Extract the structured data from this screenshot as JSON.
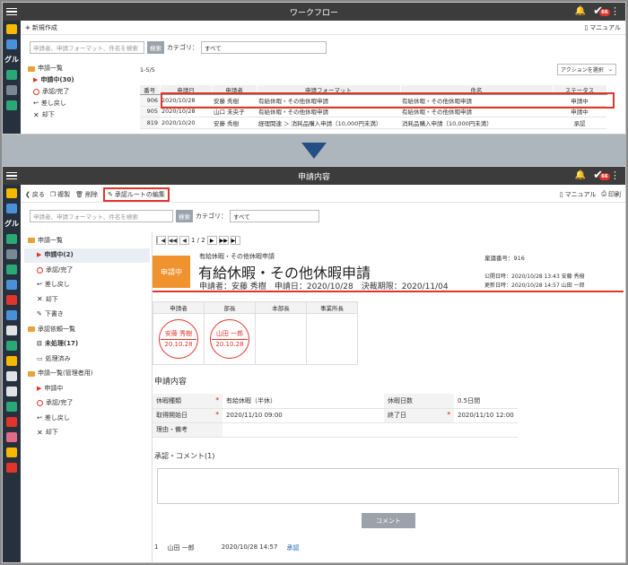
{
  "colors": {
    "nav_bg": "#27313e",
    "titlebar_bg": "#3c3c3c",
    "accent_red": "#e0352b",
    "status_orange": "#f0922e",
    "arrow_blue": "#254e86"
  },
  "badge_count": "66",
  "nav_label": "グル",
  "panel1": {
    "title": "ワークフロー",
    "new_label": "新規作成",
    "manual_label": "マニュアル",
    "search_placeholder": "申請者、申請フォーマット、件名を検索",
    "search_button": "検索",
    "category_label": "カテゴリ：",
    "category_value": "すべて",
    "tree": [
      {
        "label": "申請一覧",
        "icon": "folder-icon"
      },
      {
        "label": "申請中(30)",
        "icon": "play-icon"
      },
      {
        "label": "承認/完了",
        "icon": "circle-icon"
      },
      {
        "label": "差し戻し",
        "icon": "return-icon"
      },
      {
        "label": "却下",
        "icon": "x-icon"
      }
    ],
    "count_text": "1-5/5",
    "action_select": "アクションを選択",
    "columns": [
      "番号",
      "申請日",
      "申請者",
      "申請フォーマット",
      "件名",
      "ステータス"
    ],
    "rows": [
      {
        "no": "906",
        "date": "2020/10/28",
        "user": "安藤 秀樹",
        "format": "有給休暇・その他休暇申請",
        "subject": "有給休暇・その他休暇申請",
        "status": "申請中"
      },
      {
        "no": "905",
        "date": "2020/10/28",
        "user": "山口 未央子",
        "format": "有給休暇・その他休暇申請",
        "subject": "有給休暇・その他休暇申請",
        "status": "申請中"
      },
      {
        "no": "819",
        "date": "2020/10/20",
        "user": "安藤 秀樹",
        "format": "経理関連 ＞ 消耗品購入申請（10,000円未満）",
        "subject": "消耗品購入申請（10,000円未満）",
        "status": "承認"
      }
    ]
  },
  "panel2": {
    "title": "申請内容",
    "back_label": "戻る",
    "copy_label": "複製",
    "delete_label": "削除",
    "edit_route_label": "承認ルートの編集",
    "manual_label": "マニュアル",
    "print_label": "印刷",
    "search_placeholder": "申請者、申請フォーマット、件名を検索",
    "search_button": "検索",
    "category_label": "カテゴリ：",
    "category_value": "すべて",
    "tree": [
      {
        "label": "申請一覧",
        "icon": "folder-icon",
        "indent": 0,
        "bold": false
      },
      {
        "label": "申請中(2)",
        "icon": "play-icon",
        "indent": 1,
        "bold": true
      },
      {
        "label": "承認/完了",
        "icon": "circle-icon",
        "indent": 1,
        "bold": false
      },
      {
        "label": "差し戻し",
        "icon": "return-icon",
        "indent": 1,
        "bold": false
      },
      {
        "label": "却下",
        "icon": "x-icon",
        "indent": 1,
        "bold": false
      },
      {
        "label": "下書き",
        "icon": "pencil-icon",
        "indent": 1,
        "bold": false
      },
      {
        "label": "承認依頼一覧",
        "icon": "folder-icon",
        "indent": 0,
        "bold": false
      },
      {
        "label": "未処理(17)",
        "icon": "inbox-icon",
        "indent": 1,
        "bold": true
      },
      {
        "label": "処理済み",
        "icon": "tray-icon",
        "indent": 1,
        "bold": false
      },
      {
        "label": "申請一覧(管理者用)",
        "icon": "folder-icon",
        "indent": 0,
        "bold": false
      },
      {
        "label": "申請中",
        "icon": "play-icon",
        "indent": 1,
        "bold": false
      },
      {
        "label": "承認/完了",
        "icon": "circle-icon",
        "indent": 1,
        "bold": false
      },
      {
        "label": "差し戻し",
        "icon": "return-icon",
        "indent": 1,
        "bold": false
      },
      {
        "label": "却下",
        "icon": "x-icon",
        "indent": 1,
        "bold": false
      }
    ],
    "pager": "1 / 2",
    "status": "申請中",
    "format_name": "有給休暇・その他休暇申請",
    "subject": "有給休暇・その他休暇申請",
    "applicant_line": "申請者：安藤 秀樹　申請日：2020/10/28　決裁期限：2020/11/04",
    "doc_no": "稟議番号：916",
    "published": "公開日時：2020/10/28 13:43 安藤 秀樹",
    "updated": "更新日時：2020/10/28 14:57 山田 一郎",
    "approval_columns": [
      "申請者",
      "部長",
      "本部長",
      "事業所長"
    ],
    "stamps": [
      {
        "name": "安藤 秀樹",
        "date": "20.10.28"
      },
      {
        "name": "山田 一郎",
        "date": "20.10.28"
      }
    ],
    "details_title": "申請内容",
    "details": [
      {
        "l1": "休暇種類",
        "req1": true,
        "v1": "有給休暇（半休）",
        "l2": "休暇日数",
        "req2": false,
        "v2": "0.5日間"
      },
      {
        "l1": "取得開始日",
        "req1": true,
        "v1": "2020/11/10 09:00",
        "l2": "終了日",
        "req2": true,
        "v2": "2020/11/10 12:00"
      },
      {
        "l1": "理由・備考",
        "req1": false,
        "v1": "",
        "l2": "",
        "req2": false,
        "v2": ""
      }
    ],
    "comments_title": "承認・コメント(1)",
    "comment_button": "コメント",
    "history": {
      "no": "1",
      "user": "山田 一郎",
      "time": "2020/10/28 14:57",
      "action": "承認"
    }
  }
}
